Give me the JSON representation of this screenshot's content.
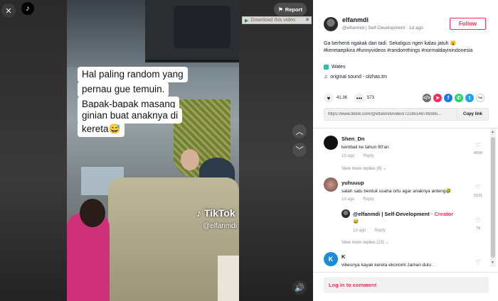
{
  "video": {
    "caption_lines": [
      "Hal paling random yang",
      "pernau gue temuin.",
      "Bapak-bapak masang",
      "ginian buat anaknya di",
      "kereta😅"
    ],
    "watermark_logo": "TikTok",
    "watermark_user": "@elfanmdi"
  },
  "controls": {
    "report_label": "Report",
    "download_label": "Download this video"
  },
  "author": {
    "username": "elfanmdi",
    "subtitle": "@elfanmdi | Self-Development · 1d ago",
    "follow_label": "Follow"
  },
  "description": {
    "text": "Ga berhenti ngakak dari tadi. Sekaligus ngeri kalau jatuh 😮",
    "hashtags": "#keretaepikira #funnyvideos #randomthings #normaldayinindonesia",
    "location": "Wates",
    "sound": "original sound - olzhas.tm"
  },
  "stats": {
    "likes": "41.3K",
    "comments": "573"
  },
  "link": {
    "url": "https://www.tiktok.com/@elfanmdi/video/72285148789385...",
    "copy_label": "Copy link"
  },
  "comments": [
    {
      "name": "Shen_Dn",
      "text": "kembali ke tahun 90'an",
      "time": "1d ago",
      "reply_label": "Reply",
      "likes": "4658",
      "more": "View more replies (8)"
    },
    {
      "name": "yuhuuup",
      "text": "salah satu bentuk usaha ortu agar anaknya anteng🤣",
      "time": "1d ago",
      "reply_label": "Reply",
      "likes": "1531",
      "more": "View more replies (23)",
      "reply": {
        "name": "@elfanmdi | Self-Development",
        "creator_tag": "· Creator",
        "text": "😅",
        "time": "1d ago",
        "reply_label": "Reply",
        "likes": "78"
      }
    },
    {
      "name": "K",
      "avatar_letter": "K",
      "text": "vibesnya kayak kereta ekonomi zaman dulu .",
      "likes": ""
    }
  ],
  "login_label": "Log in to comment",
  "icons": {
    "close": "close-icon",
    "tiktok": "tiktok-logo-icon",
    "flag": "flag-icon",
    "up": "chevron-up-icon",
    "down": "chevron-down-icon",
    "volume": "volume-icon"
  },
  "colors": {
    "accent": "#fe2c55",
    "location": "#20c3a3"
  }
}
